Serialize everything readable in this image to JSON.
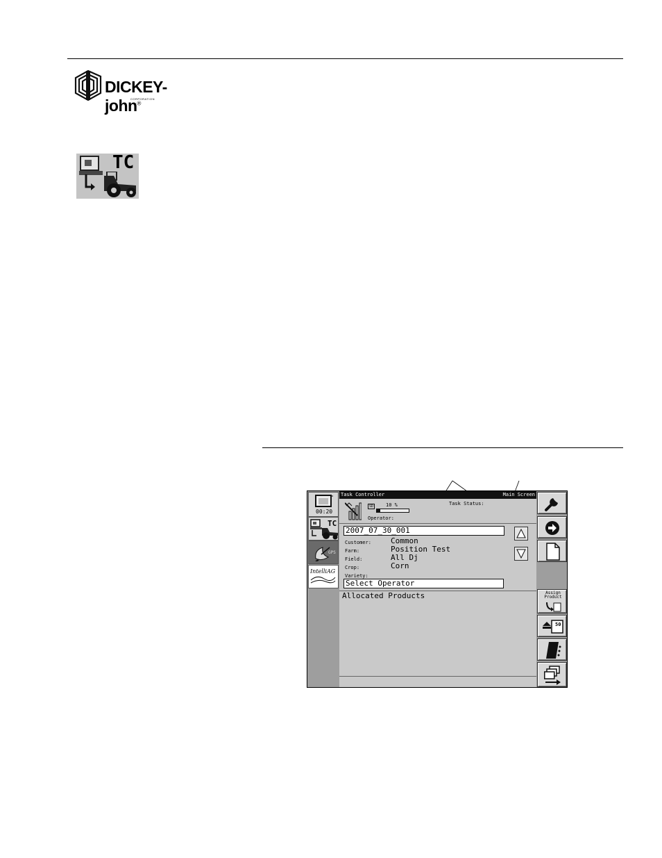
{
  "logo": {
    "name": "DICKEY-john",
    "registered": "®",
    "sub": "CORPORATION"
  },
  "tc_icon": {
    "label": "TC"
  },
  "device": {
    "title": "Task Controller",
    "screen_name": "Main Screen",
    "clock": "00:20",
    "task_status_label": "Task Status:",
    "progress_text": "10 %",
    "progress_value": 10,
    "sd_label": "SD",
    "operator_label": "Operator:",
    "task_id": "2007_07_30_001",
    "fields": [
      {
        "label": "Customer:",
        "value": "Common"
      },
      {
        "label": "Farm:",
        "value": "Position Test"
      },
      {
        "label": "Field:",
        "value": "All Dj"
      },
      {
        "label": "Crop:",
        "value": "Corn"
      },
      {
        "label": "Variety:",
        "value": ""
      }
    ],
    "select_operator": "Select Operator",
    "allocated_products": "Allocated Products",
    "gps_label": "GPS",
    "intellag_label": "IntelliAG",
    "assign_product": "Assign Product",
    "stack_value": "50"
  }
}
